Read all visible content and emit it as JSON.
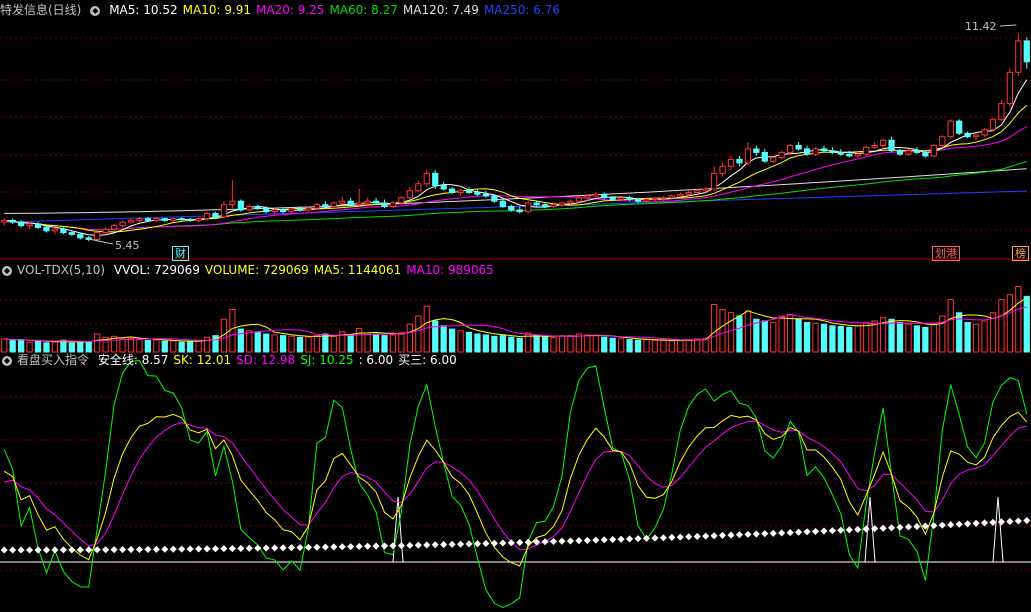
{
  "header_main": {
    "title": "特发信息(日线)",
    "items": [
      {
        "label": "MA5: 10.52",
        "color": "#ffffff"
      },
      {
        "label": "MA10: 9.91",
        "color": "#ffff00"
      },
      {
        "label": "MA20: 9.25",
        "color": "#ff00ff"
      },
      {
        "label": "MA60: 8.27",
        "color": "#00e000"
      },
      {
        "label": "MA120: 7.49",
        "color": "#e0e0e0"
      },
      {
        "label": "MA250: 6.76",
        "color": "#2040ff"
      }
    ]
  },
  "header_vol": {
    "title": "VOL-TDX(5,10)",
    "items": [
      {
        "label": "VVOL: 729069",
        "color": "#ffffff"
      },
      {
        "label": "VOLUME: 729069",
        "color": "#ffff00"
      },
      {
        "label": "MA5: 1144061",
        "color": "#ffff00"
      },
      {
        "label": "MA10: 989065",
        "color": "#ff00ff"
      }
    ]
  },
  "header_ind": {
    "title": "看盘买入指令",
    "items": [
      {
        "label": "安全线: 8.57",
        "color": "#ffffff"
      },
      {
        "label": "SK: 12.01",
        "color": "#ffff00"
      },
      {
        "label": "SD: 12.98",
        "color": "#ff00ff"
      },
      {
        "label": "SJ: 10.25",
        "color": "#00ff00"
      },
      {
        "label": ": 6.00",
        "color": "#ffffff"
      },
      {
        "label": "买三: 6.00",
        "color": "#ffffff"
      }
    ]
  },
  "annotations": {
    "high_label": "11.42",
    "low_label": "5.45",
    "badge1": "财",
    "badge2": "划港",
    "badge3": "榜"
  },
  "colors": {
    "up": "#ff3232",
    "down": "#54fcfc",
    "grid": "#780000",
    "ma5": "#ffffff",
    "ma10": "#ffff00",
    "ma20": "#ff00ff",
    "ma60": "#00e000",
    "ma120": "#e0e0e0",
    "ma250": "#2040ff",
    "sk": "#ffff00",
    "sd": "#ff00ff",
    "sj": "#00ff00"
  },
  "chart_data": {
    "type": "candlestick",
    "ylim": [
      5.2,
      11.8
    ],
    "candles": [
      [
        6.0,
        6.1,
        5.9,
        6.05
      ],
      [
        6.05,
        6.1,
        5.95,
        6.0
      ],
      [
        6.0,
        6.05,
        5.85,
        5.9
      ],
      [
        5.9,
        5.98,
        5.8,
        5.95
      ],
      [
        5.95,
        6.0,
        5.8,
        5.85
      ],
      [
        5.85,
        5.9,
        5.7,
        5.75
      ],
      [
        5.75,
        5.85,
        5.65,
        5.8
      ],
      [
        5.8,
        5.85,
        5.65,
        5.7
      ],
      [
        5.7,
        5.75,
        5.6,
        5.65
      ],
      [
        5.65,
        5.7,
        5.5,
        5.55
      ],
      [
        5.55,
        5.6,
        5.45,
        5.5
      ],
      [
        5.5,
        5.75,
        5.45,
        5.7
      ],
      [
        5.7,
        5.85,
        5.65,
        5.8
      ],
      [
        5.8,
        5.95,
        5.75,
        5.9
      ],
      [
        5.9,
        6.05,
        5.85,
        6.0
      ],
      [
        6.0,
        6.1,
        5.95,
        6.05
      ],
      [
        6.05,
        6.15,
        6.0,
        6.1
      ],
      [
        6.1,
        6.15,
        6.0,
        6.05
      ],
      [
        6.05,
        6.15,
        6.0,
        6.1
      ],
      [
        6.1,
        6.12,
        6.0,
        6.05
      ],
      [
        6.05,
        6.12,
        6.0,
        6.1
      ],
      [
        6.1,
        6.15,
        6.05,
        6.08
      ],
      [
        6.08,
        6.12,
        6.0,
        6.05
      ],
      [
        6.05,
        6.15,
        6.0,
        6.1
      ],
      [
        6.1,
        6.3,
        6.05,
        6.25
      ],
      [
        6.25,
        6.3,
        6.1,
        6.15
      ],
      [
        6.15,
        6.6,
        6.1,
        6.5
      ],
      [
        6.5,
        7.2,
        6.4,
        6.6
      ],
      [
        6.6,
        6.65,
        6.3,
        6.35
      ],
      [
        6.35,
        6.5,
        6.3,
        6.45
      ],
      [
        6.45,
        6.5,
        6.35,
        6.4
      ],
      [
        6.4,
        6.45,
        6.25,
        6.3
      ],
      [
        6.3,
        6.4,
        6.2,
        6.35
      ],
      [
        6.35,
        6.4,
        6.25,
        6.3
      ],
      [
        6.3,
        6.4,
        6.25,
        6.38
      ],
      [
        6.38,
        6.45,
        6.3,
        6.35
      ],
      [
        6.35,
        6.45,
        6.3,
        6.4
      ],
      [
        6.4,
        6.55,
        6.35,
        6.5
      ],
      [
        6.5,
        6.6,
        6.4,
        6.45
      ],
      [
        6.45,
        6.6,
        6.4,
        6.55
      ],
      [
        6.55,
        6.75,
        6.5,
        6.6
      ],
      [
        6.6,
        6.7,
        6.45,
        6.5
      ],
      [
        6.5,
        6.95,
        6.45,
        6.55
      ],
      [
        6.55,
        6.7,
        6.45,
        6.6
      ],
      [
        6.6,
        6.7,
        6.5,
        6.55
      ],
      [
        6.55,
        6.65,
        6.4,
        6.45
      ],
      [
        6.45,
        6.6,
        6.4,
        6.55
      ],
      [
        6.55,
        6.75,
        6.5,
        6.7
      ],
      [
        6.7,
        7.0,
        6.65,
        6.9
      ],
      [
        6.9,
        7.2,
        6.85,
        7.1
      ],
      [
        7.1,
        7.5,
        7.0,
        7.4
      ],
      [
        7.4,
        7.5,
        6.95,
        7.05
      ],
      [
        7.05,
        7.15,
        6.9,
        6.95
      ],
      [
        6.95,
        7.0,
        6.8,
        6.85
      ],
      [
        6.85,
        6.95,
        6.75,
        6.9
      ],
      [
        6.9,
        7.0,
        6.8,
        6.85
      ],
      [
        6.85,
        6.95,
        6.75,
        6.8
      ],
      [
        6.8,
        6.9,
        6.7,
        6.75
      ],
      [
        6.75,
        6.8,
        6.55,
        6.6
      ],
      [
        6.6,
        6.65,
        6.4,
        6.45
      ],
      [
        6.45,
        6.5,
        6.3,
        6.35
      ],
      [
        6.35,
        6.45,
        6.25,
        6.3
      ],
      [
        6.3,
        6.6,
        6.25,
        6.55
      ],
      [
        6.55,
        6.6,
        6.45,
        6.5
      ],
      [
        6.5,
        6.55,
        6.4,
        6.45
      ],
      [
        6.45,
        6.55,
        6.4,
        6.5
      ],
      [
        6.5,
        6.6,
        6.45,
        6.55
      ],
      [
        6.55,
        6.65,
        6.5,
        6.6
      ],
      [
        6.6,
        6.75,
        6.55,
        6.7
      ],
      [
        6.7,
        6.8,
        6.6,
        6.75
      ],
      [
        6.75,
        6.85,
        6.7,
        6.8
      ],
      [
        6.8,
        6.85,
        6.65,
        6.7
      ],
      [
        6.7,
        6.75,
        6.6,
        6.65
      ],
      [
        6.65,
        6.75,
        6.6,
        6.7
      ],
      [
        6.7,
        6.75,
        6.6,
        6.65
      ],
      [
        6.65,
        6.7,
        6.55,
        6.6
      ],
      [
        6.6,
        6.7,
        6.55,
        6.65
      ],
      [
        6.65,
        6.7,
        6.6,
        6.68
      ],
      [
        6.68,
        6.75,
        6.6,
        6.7
      ],
      [
        6.7,
        6.8,
        6.65,
        6.75
      ],
      [
        6.75,
        6.85,
        6.7,
        6.8
      ],
      [
        6.8,
        6.9,
        6.75,
        6.85
      ],
      [
        6.85,
        6.95,
        6.8,
        6.9
      ],
      [
        6.9,
        7.0,
        6.85,
        6.95
      ],
      [
        6.95,
        7.6,
        6.9,
        7.4
      ],
      [
        7.4,
        7.7,
        7.3,
        7.6
      ],
      [
        7.6,
        7.9,
        7.5,
        7.8
      ],
      [
        7.8,
        7.9,
        7.6,
        7.7
      ],
      [
        7.7,
        8.3,
        7.65,
        8.1
      ],
      [
        8.1,
        8.2,
        7.9,
        8.0
      ],
      [
        8.0,
        8.1,
        7.7,
        7.75
      ],
      [
        7.75,
        7.9,
        7.7,
        7.85
      ],
      [
        7.85,
        8.05,
        7.8,
        8.0
      ],
      [
        8.0,
        8.25,
        7.95,
        8.2
      ],
      [
        8.2,
        8.3,
        8.05,
        8.1
      ],
      [
        8.1,
        8.2,
        7.9,
        7.95
      ],
      [
        7.95,
        8.15,
        7.9,
        8.1
      ],
      [
        8.1,
        8.2,
        8.0,
        8.05
      ],
      [
        8.05,
        8.15,
        7.95,
        8.0
      ],
      [
        8.0,
        8.1,
        7.9,
        7.95
      ],
      [
        7.95,
        8.05,
        7.85,
        7.9
      ],
      [
        7.9,
        8.0,
        7.85,
        7.95
      ],
      [
        7.95,
        8.2,
        7.9,
        8.15
      ],
      [
        8.15,
        8.3,
        8.1,
        8.2
      ],
      [
        8.2,
        8.4,
        8.1,
        8.35
      ],
      [
        8.35,
        8.45,
        8.0,
        8.05
      ],
      [
        8.05,
        8.1,
        7.9,
        7.95
      ],
      [
        7.95,
        8.1,
        7.9,
        8.05
      ],
      [
        8.05,
        8.15,
        7.95,
        8.0
      ],
      [
        8.0,
        8.05,
        7.85,
        7.9
      ],
      [
        7.9,
        8.25,
        7.85,
        8.2
      ],
      [
        8.2,
        8.5,
        8.15,
        8.45
      ],
      [
        8.45,
        8.95,
        8.4,
        8.9
      ],
      [
        8.9,
        8.95,
        8.5,
        8.55
      ],
      [
        8.55,
        8.6,
        8.4,
        8.45
      ],
      [
        8.45,
        8.55,
        8.35,
        8.5
      ],
      [
        8.5,
        8.7,
        8.45,
        8.65
      ],
      [
        8.65,
        9.0,
        8.6,
        8.95
      ],
      [
        8.95,
        9.5,
        8.9,
        9.4
      ],
      [
        9.4,
        10.4,
        9.3,
        10.3
      ],
      [
        10.3,
        11.42,
        10.2,
        11.2
      ],
      [
        11.2,
        11.3,
        10.4,
        10.6
      ]
    ],
    "volume": [
      40,
      35,
      38,
      30,
      34,
      28,
      30,
      36,
      28,
      32,
      30,
      55,
      45,
      48,
      40,
      42,
      38,
      35,
      37,
      33,
      34,
      30,
      32,
      36,
      45,
      50,
      100,
      130,
      70,
      65,
      60,
      55,
      52,
      50,
      48,
      45,
      46,
      50,
      55,
      48,
      62,
      52,
      72,
      58,
      55,
      50,
      52,
      60,
      85,
      110,
      140,
      95,
      80,
      70,
      65,
      60,
      55,
      52,
      48,
      50,
      45,
      42,
      58,
      50,
      46,
      44,
      48,
      50,
      55,
      52,
      50,
      45,
      42,
      40,
      38,
      36,
      38,
      36,
      35,
      34,
      36,
      38,
      40,
      42,
      145,
      130,
      120,
      110,
      125,
      100,
      95,
      90,
      110,
      115,
      100,
      90,
      88,
      85,
      80,
      78,
      75,
      80,
      90,
      95,
      105,
      100,
      90,
      85,
      80,
      75,
      85,
      110,
      160,
      120,
      90,
      85,
      95,
      120,
      160,
      175,
      200,
      170
    ],
    "vol_max": 220,
    "ind_range": [
      -10,
      110
    ]
  }
}
